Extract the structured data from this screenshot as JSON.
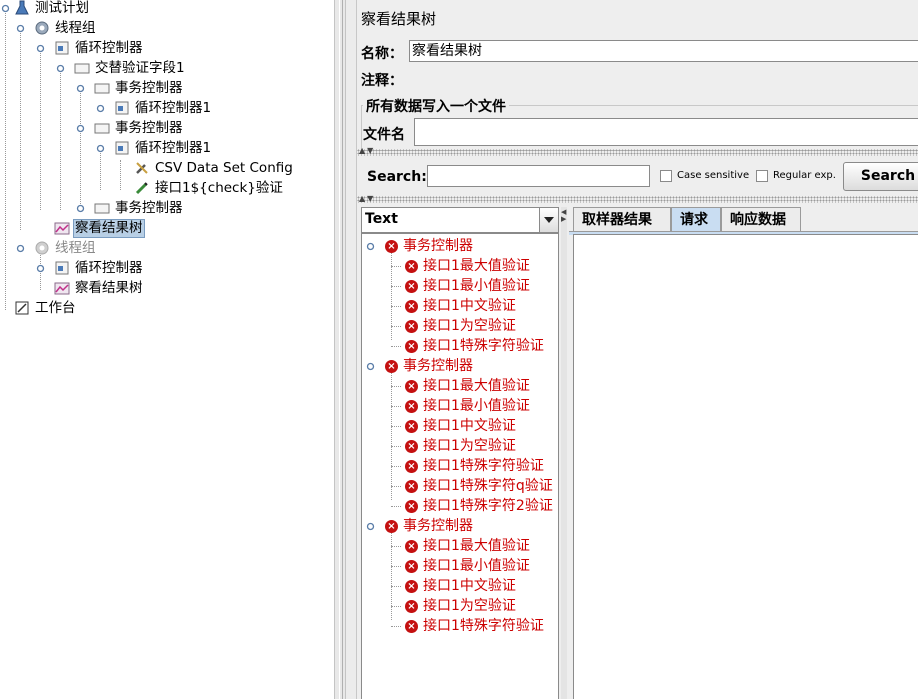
{
  "tree": {
    "root": "测试计划",
    "thread_group_1": "线程组",
    "loop_1": "循环控制器",
    "alternate": "交替验证字段1",
    "tx_1": "事务控制器",
    "loop_1a": "循环控制器1",
    "tx_2": "事务控制器",
    "loop_1b": "循环控制器1",
    "csv": "CSV Data Set Config",
    "api": "接口1${check}验证",
    "tx_3": "事务控制器",
    "result_tree_1": "察看结果树",
    "thread_group_2": "线程组",
    "loop_2": "循环控制器",
    "result_tree_2": "察看结果树",
    "workbench": "工作台"
  },
  "panel": {
    "title": "察看结果树",
    "name_label": "名称：",
    "name_value": "察看结果树",
    "comment_label": "注释：",
    "file_legend": "所有数据写入一个文件",
    "file_label": "文件名"
  },
  "search": {
    "label": "Search:",
    "value": "",
    "case_sensitive": "Case sensitive",
    "regex": "Regular exp.",
    "button": "Search"
  },
  "renderer": {
    "selected": "Text"
  },
  "results": [
    {
      "name": "事务控制器",
      "children": [
        "接口1最大值验证",
        "接口1最小值验证",
        "接口1中文验证",
        "接口1为空验证",
        "接口1特殊字符验证"
      ]
    },
    {
      "name": "事务控制器",
      "children": [
        "接口1最大值验证",
        "接口1最小值验证",
        "接口1中文验证",
        "接口1为空验证",
        "接口1特殊字符验证",
        "接口1特殊字符q验证",
        "接口1特殊字符2验证"
      ]
    },
    {
      "name": "事务控制器",
      "children": [
        "接口1最大值验证",
        "接口1最小值验证",
        "接口1中文验证",
        "接口1为空验证",
        "接口1特殊字符验证"
      ]
    }
  ],
  "tabs": [
    "取样器结果",
    "请求",
    "响应数据"
  ],
  "active_tab": "请求",
  "colors": {
    "error_text": "#cc0000",
    "selection": "#b8cfe5",
    "active_tab": "#c9ddf2"
  }
}
